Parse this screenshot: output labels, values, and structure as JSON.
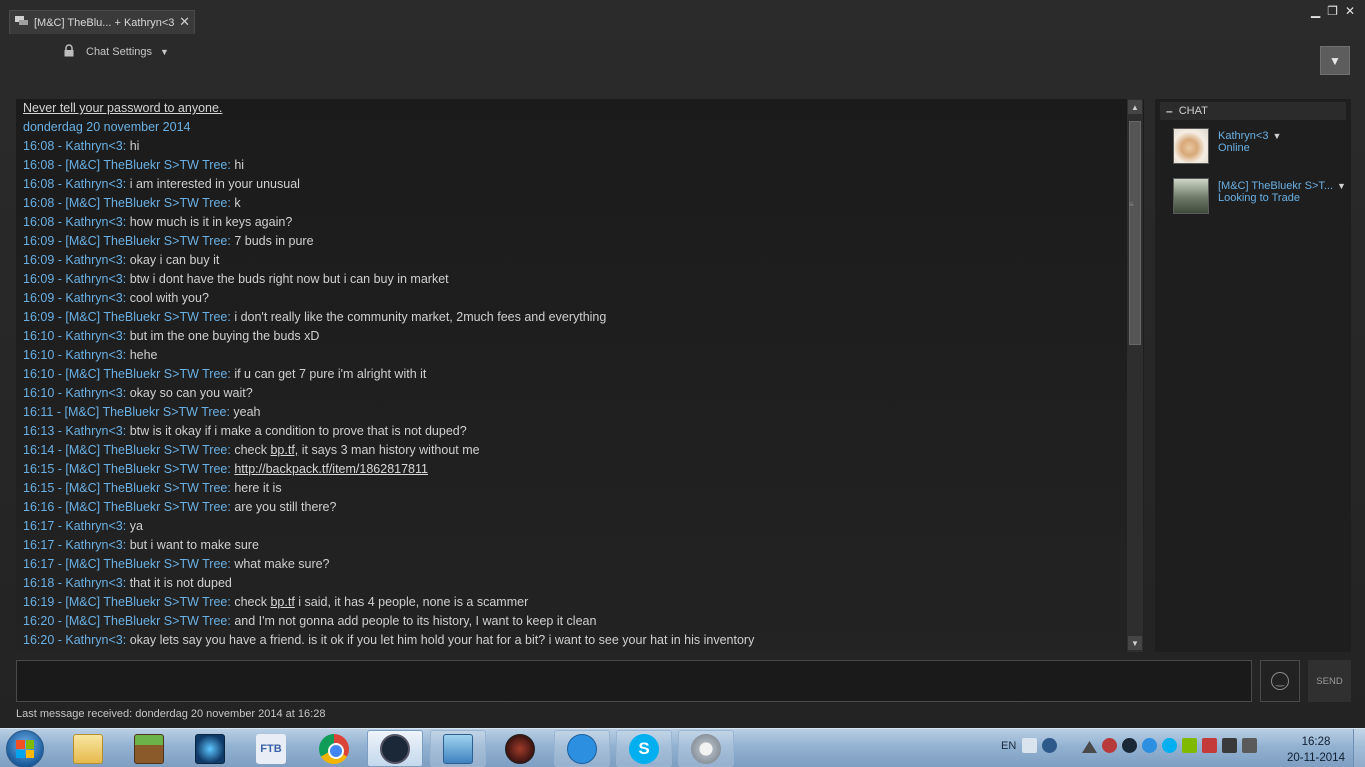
{
  "window": {
    "tab_title": "[M&C] TheBlu... + Kathryn<3",
    "settings_label": "Chat Settings"
  },
  "chat": {
    "warning": "Never tell your password to anyone.",
    "date_header": "donderdag 20 november 2014",
    "messages": [
      {
        "time": "16:08",
        "sender": "Kathryn<3",
        "text": "hi"
      },
      {
        "time": "16:08",
        "sender": "[M&C] TheBluekr S>TW Tree",
        "text": "hi"
      },
      {
        "time": "16:08",
        "sender": "Kathryn<3",
        "text": "i am interested in your unusual"
      },
      {
        "time": "16:08",
        "sender": "[M&C] TheBluekr S>TW Tree",
        "text": "k"
      },
      {
        "time": "16:08",
        "sender": "Kathryn<3",
        "text": "how much is it in keys again?"
      },
      {
        "time": "16:09",
        "sender": "[M&C] TheBluekr S>TW Tree",
        "text": "7 buds in pure"
      },
      {
        "time": "16:09",
        "sender": "Kathryn<3",
        "text": "okay i can buy it"
      },
      {
        "time": "16:09",
        "sender": "Kathryn<3",
        "text": "btw i dont have the buds right now but i can buy in market"
      },
      {
        "time": "16:09",
        "sender": "Kathryn<3",
        "text": "cool with you?"
      },
      {
        "time": "16:09",
        "sender": "[M&C] TheBluekr S>TW Tree",
        "text": "i don't really like the community market, 2much fees and everything"
      },
      {
        "time": "16:10",
        "sender": "Kathryn<3",
        "text": "but im the one buying the buds xD"
      },
      {
        "time": "16:10",
        "sender": "Kathryn<3",
        "text": "hehe"
      },
      {
        "time": "16:10",
        "sender": "[M&C] TheBluekr S>TW Tree",
        "text": "if u can get 7 pure i'm alright with it"
      },
      {
        "time": "16:10",
        "sender": "Kathryn<3",
        "text": "okay so can you wait?"
      },
      {
        "time": "16:11",
        "sender": "[M&C] TheBluekr S>TW Tree",
        "text": "yeah"
      },
      {
        "time": "16:13",
        "sender": "Kathryn<3",
        "text": "btw is it okay if i make a condition to prove that is not duped?"
      },
      {
        "time": "16:14",
        "sender": "[M&C] TheBluekr S>TW Tree",
        "text_before": "check ",
        "link": "bp.tf,",
        "text_after": " it says 3 man history without me"
      },
      {
        "time": "16:15",
        "sender": "[M&C] TheBluekr S>TW Tree",
        "text_before": "",
        "link": "http://backpack.tf/item/1862817811",
        "text_after": ""
      },
      {
        "time": "16:15",
        "sender": "[M&C] TheBluekr S>TW Tree",
        "text": "here it is"
      },
      {
        "time": "16:16",
        "sender": "[M&C] TheBluekr S>TW Tree",
        "text": "are you still there?"
      },
      {
        "time": "16:17",
        "sender": "Kathryn<3",
        "text": "ya"
      },
      {
        "time": "16:17",
        "sender": "Kathryn<3",
        "text": "but i want to make sure"
      },
      {
        "time": "16:17",
        "sender": "[M&C] TheBluekr S>TW Tree",
        "text": "what make sure?"
      },
      {
        "time": "16:18",
        "sender": "Kathryn<3",
        "text": "that it is not duped"
      },
      {
        "time": "16:19",
        "sender": "[M&C] TheBluekr S>TW Tree",
        "text_before": "check ",
        "link": "bp.tf",
        "text_after": " i said, it has 4 people, none is a scammer"
      },
      {
        "time": "16:20",
        "sender": "[M&C] TheBluekr S>TW Tree",
        "text": "and I'm not gonna add people to its history, I want to keep it clean"
      },
      {
        "time": "16:20",
        "sender": "Kathryn<3",
        "text": "okay lets say you have a friend. is it ok if you let him hold your hat for a bit? i want to see your hat in his inventory"
      }
    ]
  },
  "friends_panel": {
    "header": "CHAT",
    "friends": [
      {
        "name": "Kathryn<3",
        "status": "Online"
      },
      {
        "name": "[M&C] TheBluekr S>T...",
        "status": "Looking to Trade"
      }
    ]
  },
  "composer": {
    "send_label": "SEND",
    "last_received": "Last message received: donderdag 20 november 2014 at 16:28"
  },
  "taskbar": {
    "language": "EN",
    "time": "16:28",
    "date": "20-11-2014",
    "ftb_label": "FTB",
    "skype_letter": "S"
  }
}
